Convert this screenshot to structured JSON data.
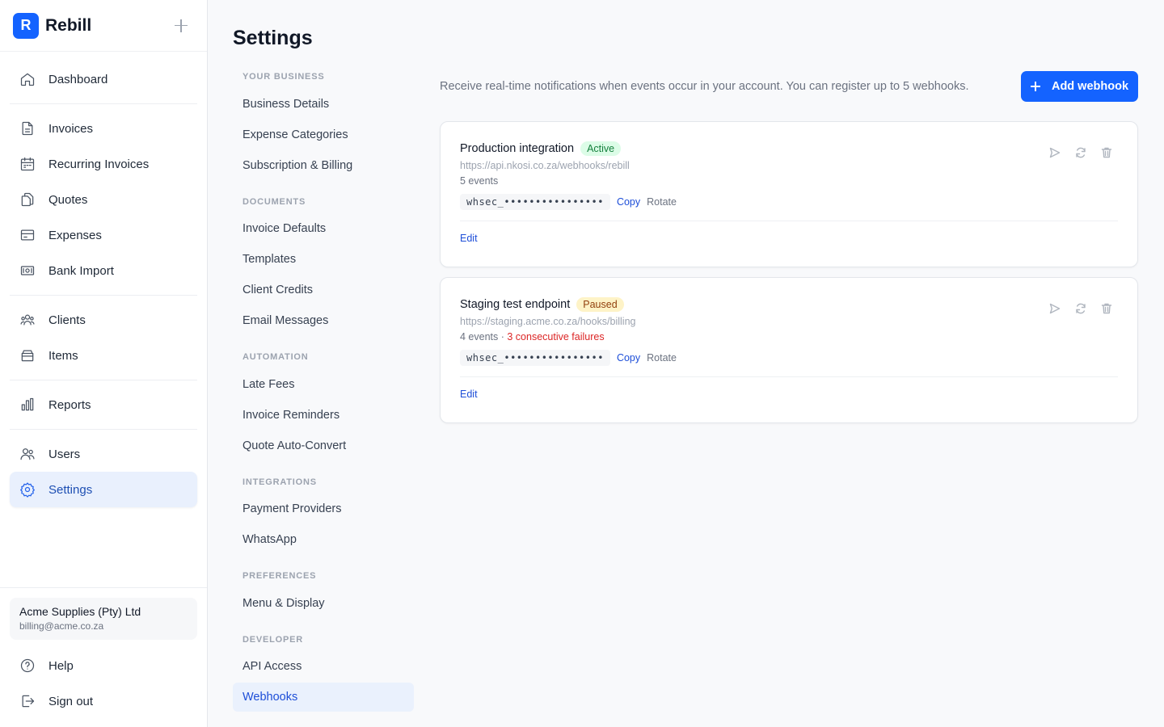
{
  "brand": {
    "logo_letter": "R",
    "name": "Rebill"
  },
  "sidebar": {
    "items": [
      {
        "label": "Dashboard",
        "icon": "home-icon"
      },
      {
        "label": "Invoices",
        "icon": "document-icon"
      },
      {
        "label": "Recurring Invoices",
        "icon": "calendar-icon"
      },
      {
        "label": "Quotes",
        "icon": "copy-document-icon"
      },
      {
        "label": "Expenses",
        "icon": "credit-card-icon"
      },
      {
        "label": "Bank Import",
        "icon": "banknote-icon"
      },
      {
        "label": "Clients",
        "icon": "people-group-icon"
      },
      {
        "label": "Items",
        "icon": "box-icon"
      },
      {
        "label": "Reports",
        "icon": "bar-chart-icon"
      },
      {
        "label": "Users",
        "icon": "users-icon"
      },
      {
        "label": "Settings",
        "icon": "gear-icon",
        "active": true
      }
    ],
    "account": {
      "name": "Acme Supplies (Pty) Ltd",
      "email": "billing@acme.co.za"
    },
    "help_label": "Help",
    "signout_label": "Sign out"
  },
  "page": {
    "title": "Settings"
  },
  "settings_nav": {
    "groups": [
      {
        "heading": "YOUR BUSINESS",
        "items": [
          "Business Details",
          "Expense Categories",
          "Subscription & Billing"
        ]
      },
      {
        "heading": "DOCUMENTS",
        "items": [
          "Invoice Defaults",
          "Templates",
          "Client Credits",
          "Email Messages"
        ]
      },
      {
        "heading": "AUTOMATION",
        "items": [
          "Late Fees",
          "Invoice Reminders",
          "Quote Auto-Convert"
        ]
      },
      {
        "heading": "INTEGRATIONS",
        "items": [
          "Payment Providers",
          "WhatsApp"
        ]
      },
      {
        "heading": "PREFERENCES",
        "items": [
          "Menu & Display"
        ]
      },
      {
        "heading": "DEVELOPER",
        "items": [
          "API Access",
          "Webhooks"
        ]
      }
    ],
    "active_item": "Webhooks"
  },
  "webhooks": {
    "intro": "Receive real-time notifications when events occur in your account. You can register up to 5 webhooks.",
    "add_button_label": "Add webhook",
    "items": [
      {
        "name": "Production integration",
        "status": "Active",
        "url": "https://api.nkosi.co.za/webhooks/rebill",
        "events": "5 events",
        "separator": "",
        "failures": "",
        "secret": "whsec_••••••••••••••••",
        "copy_label": "Copy",
        "rotate_label": "Rotate",
        "edit_label": "Edit"
      },
      {
        "name": "Staging test endpoint",
        "status": "Paused",
        "url": "https://staging.acme.co.za/hooks/billing",
        "events": "4 events",
        "separator": " · ",
        "failures": "3 consecutive failures",
        "secret": "whsec_••••••••••••••••",
        "copy_label": "Copy",
        "rotate_label": "Rotate",
        "edit_label": "Edit"
      }
    ]
  },
  "colors": {
    "accent": "#1463ff",
    "active_badge_bg": "#dcfce7",
    "paused_badge_bg": "#fef3c7",
    "failure_text": "#dc2626"
  }
}
